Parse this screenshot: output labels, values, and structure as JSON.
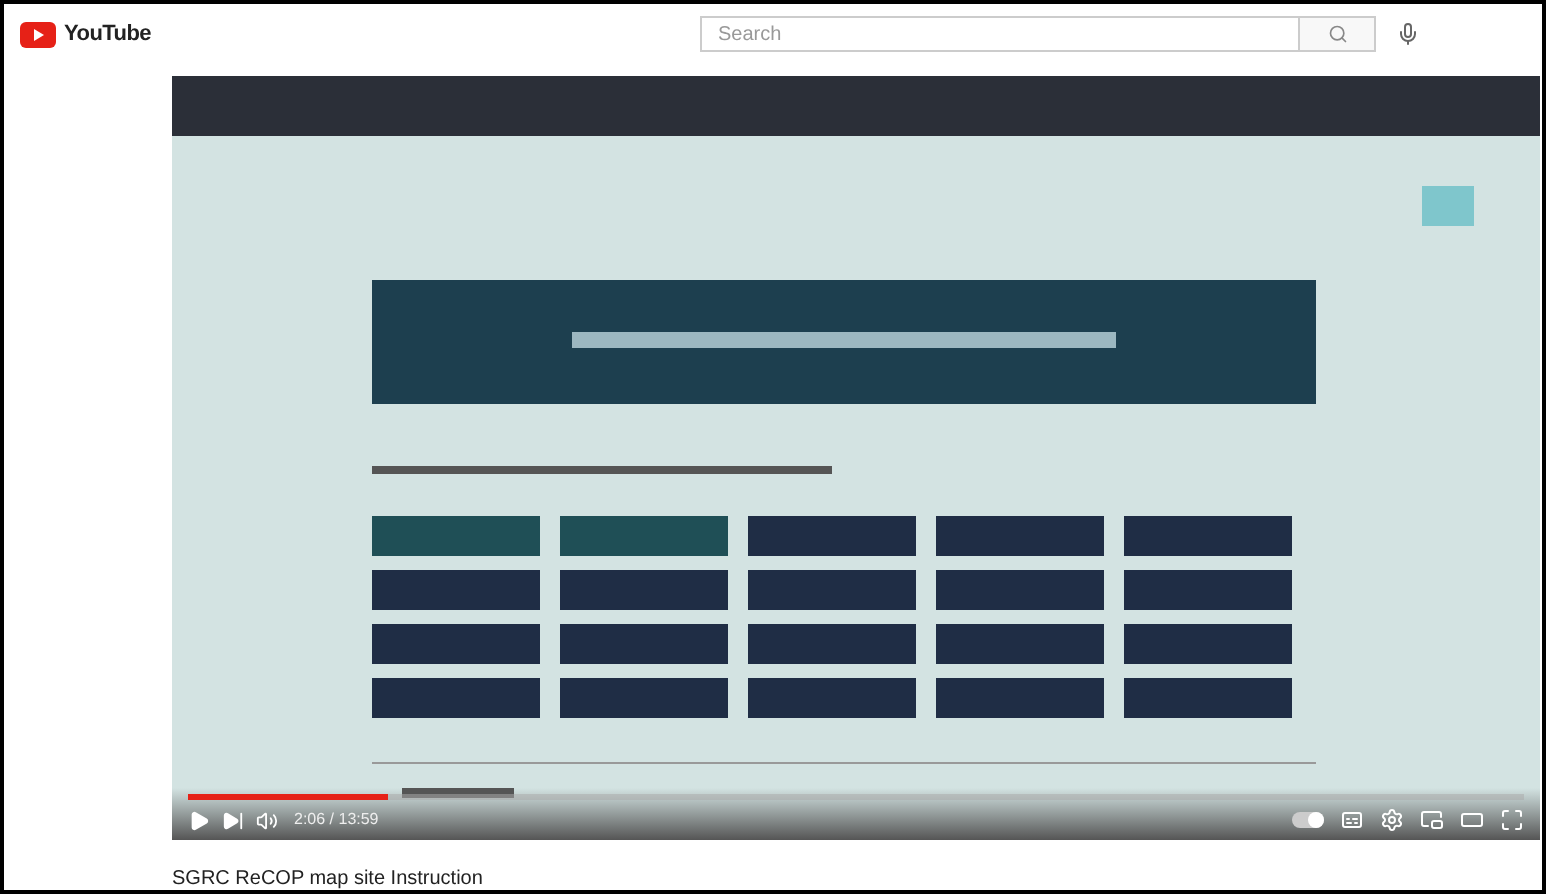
{
  "header": {
    "logo": "YouTube",
    "search": {
      "placeholder": "Search"
    }
  },
  "player": {
    "autoplay": {
      "on": true
    },
    "progress": {
      "level": 0.15
    },
    "time": "2:06 / 13:59"
  },
  "video": {
    "title": "SGRC ReCOP map site Instruction"
  }
}
